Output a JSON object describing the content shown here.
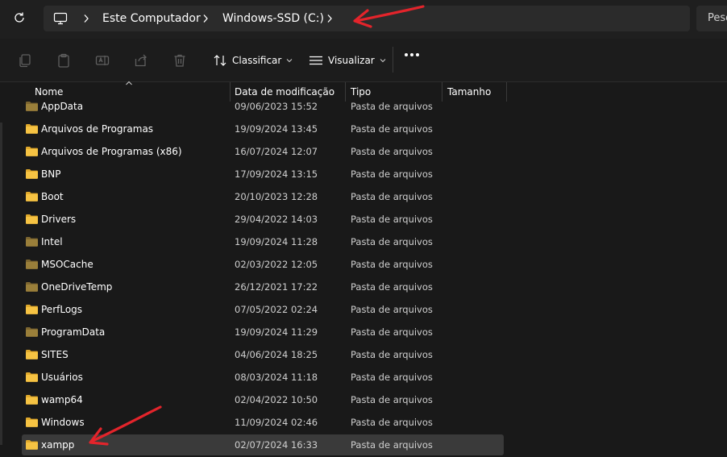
{
  "address": {
    "crumbs": [
      "Este Computador",
      "Windows-SSD (C:)"
    ],
    "search_placeholder": "Pesquisar"
  },
  "toolbar": {
    "sort_label": "Classificar",
    "view_label": "Visualizar"
  },
  "columns": {
    "name": "Nome",
    "date": "Data de modificação",
    "type": "Tipo",
    "size": "Tamanho"
  },
  "rows": [
    {
      "name": "AppData",
      "date": "09/06/2023 15:52",
      "type": "Pasta de arquivos",
      "hidden": true
    },
    {
      "name": "Arquivos de Programas",
      "date": "19/09/2024 13:45",
      "type": "Pasta de arquivos",
      "hidden": false
    },
    {
      "name": "Arquivos de Programas (x86)",
      "date": "16/07/2024 12:07",
      "type": "Pasta de arquivos",
      "hidden": false
    },
    {
      "name": "BNP",
      "date": "17/09/2024 13:15",
      "type": "Pasta de arquivos",
      "hidden": false
    },
    {
      "name": "Boot",
      "date": "20/10/2023 12:28",
      "type": "Pasta de arquivos",
      "hidden": false
    },
    {
      "name": "Drivers",
      "date": "29/04/2022 14:03",
      "type": "Pasta de arquivos",
      "hidden": false
    },
    {
      "name": "Intel",
      "date": "19/09/2024 11:28",
      "type": "Pasta de arquivos",
      "hidden": true
    },
    {
      "name": "MSOCache",
      "date": "02/03/2022 12:05",
      "type": "Pasta de arquivos",
      "hidden": true
    },
    {
      "name": "OneDriveTemp",
      "date": "26/12/2021 17:22",
      "type": "Pasta de arquivos",
      "hidden": true
    },
    {
      "name": "PerfLogs",
      "date": "07/05/2022 02:24",
      "type": "Pasta de arquivos",
      "hidden": false
    },
    {
      "name": "ProgramData",
      "date": "19/09/2024 11:29",
      "type": "Pasta de arquivos",
      "hidden": true
    },
    {
      "name": "SITES",
      "date": "04/06/2024 18:25",
      "type": "Pasta de arquivos",
      "hidden": false
    },
    {
      "name": "Usuários",
      "date": "08/03/2024 11:18",
      "type": "Pasta de arquivos",
      "hidden": false
    },
    {
      "name": "wamp64",
      "date": "02/04/2022 10:50",
      "type": "Pasta de arquivos",
      "hidden": false
    },
    {
      "name": "Windows",
      "date": "11/09/2024 02:46",
      "type": "Pasta de arquivos",
      "hidden": false
    },
    {
      "name": "xampp",
      "date": "02/07/2024 16:33",
      "type": "Pasta de arquivos",
      "hidden": false,
      "selected": true
    }
  ],
  "colors": {
    "folder": "#f6c343",
    "folder_hidden": "#9a7f3a",
    "annotation": "#e3242b"
  },
  "icons": {
    "refresh": "refresh-icon",
    "computer": "computer-icon",
    "copy": "copy-icon",
    "paste": "paste-icon",
    "rename": "rename-icon",
    "share": "share-icon",
    "delete": "delete-icon",
    "sort": "sort-icon",
    "view": "view-icon",
    "more": "more-icon",
    "folder": "folder-icon"
  }
}
